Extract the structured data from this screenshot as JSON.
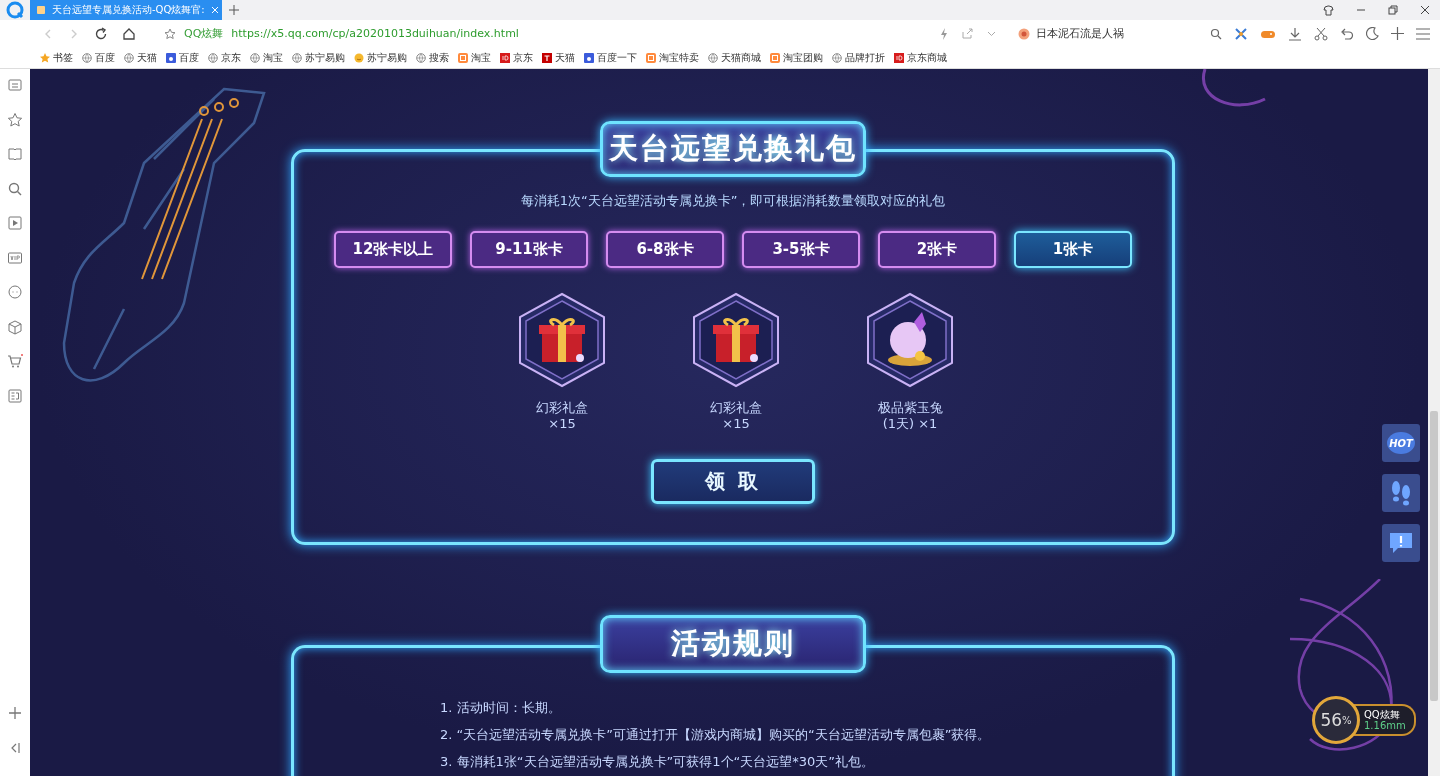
{
  "browser": {
    "tab": {
      "title": "天台远望专属兑换活动-QQ炫舞官:"
    },
    "address": {
      "site_label": "QQ炫舞",
      "url": "https://x5.qq.com/cp/a20201013duihuan/index.html"
    },
    "search": {
      "value": "日本泥石流是人祸"
    },
    "bookmarks": [
      {
        "label": "书签",
        "kind": "star"
      },
      {
        "label": "百度",
        "kind": "globe"
      },
      {
        "label": "天猫",
        "kind": "globe"
      },
      {
        "label": "百度",
        "kind": "paw"
      },
      {
        "label": "京东",
        "kind": "globe"
      },
      {
        "label": "淘宝",
        "kind": "globe"
      },
      {
        "label": "苏宁易购",
        "kind": "globe"
      },
      {
        "label": "苏宁易购",
        "kind": "smile"
      },
      {
        "label": "搜索",
        "kind": "globe"
      },
      {
        "label": "淘宝",
        "kind": "tao"
      },
      {
        "label": "京东",
        "kind": "jd"
      },
      {
        "label": "天猫",
        "kind": "tmall"
      },
      {
        "label": "百度一下",
        "kind": "paw"
      },
      {
        "label": "淘宝特卖",
        "kind": "tao"
      },
      {
        "label": "天猫商城",
        "kind": "globe"
      },
      {
        "label": "淘宝团购",
        "kind": "tao"
      },
      {
        "label": "品牌打折",
        "kind": "globe"
      },
      {
        "label": "京东商城",
        "kind": "jd"
      }
    ]
  },
  "exchange": {
    "title": "天台远望兑换礼包",
    "subtitle": "每消耗1次“天台远望活动专属兑换卡”，即可根据消耗数量领取对应的礼包",
    "tiers": [
      {
        "label": "12张卡以上",
        "selected": false
      },
      {
        "label": "9-11张卡",
        "selected": false
      },
      {
        "label": "6-8张卡",
        "selected": false
      },
      {
        "label": "3-5张卡",
        "selected": false
      },
      {
        "label": "2张卡",
        "selected": false
      },
      {
        "label": "1张卡",
        "selected": true
      }
    ],
    "rewards": [
      {
        "kind": "gift",
        "name": "幻彩礼盒",
        "quantity": "×15"
      },
      {
        "kind": "gift",
        "name": "幻彩礼盒",
        "quantity": "×15"
      },
      {
        "kind": "orb",
        "name": "极品紫玉兔",
        "quantity": "(1天) ×1"
      }
    ],
    "claim_button": "领 取"
  },
  "rules": {
    "title": "活动规则",
    "items": [
      "1. 活动时间：长期。",
      "2. “天台远望活动专属兑换卡”可通过打开【游戏内商城】购买的“天台远望活动专属包裹”获得。",
      "3. 每消耗1张“天台远望活动专属兑换卡”可获得1个“天台远望*30天”礼包。"
    ]
  },
  "float_buttons": [
    {
      "kind": "hot",
      "label": "HOT"
    },
    {
      "kind": "footprints"
    },
    {
      "kind": "feedback"
    }
  ],
  "speed_widget": {
    "percent": "56",
    "unit": "%",
    "name": "QQ炫舞",
    "reading": "1.16mm"
  }
}
